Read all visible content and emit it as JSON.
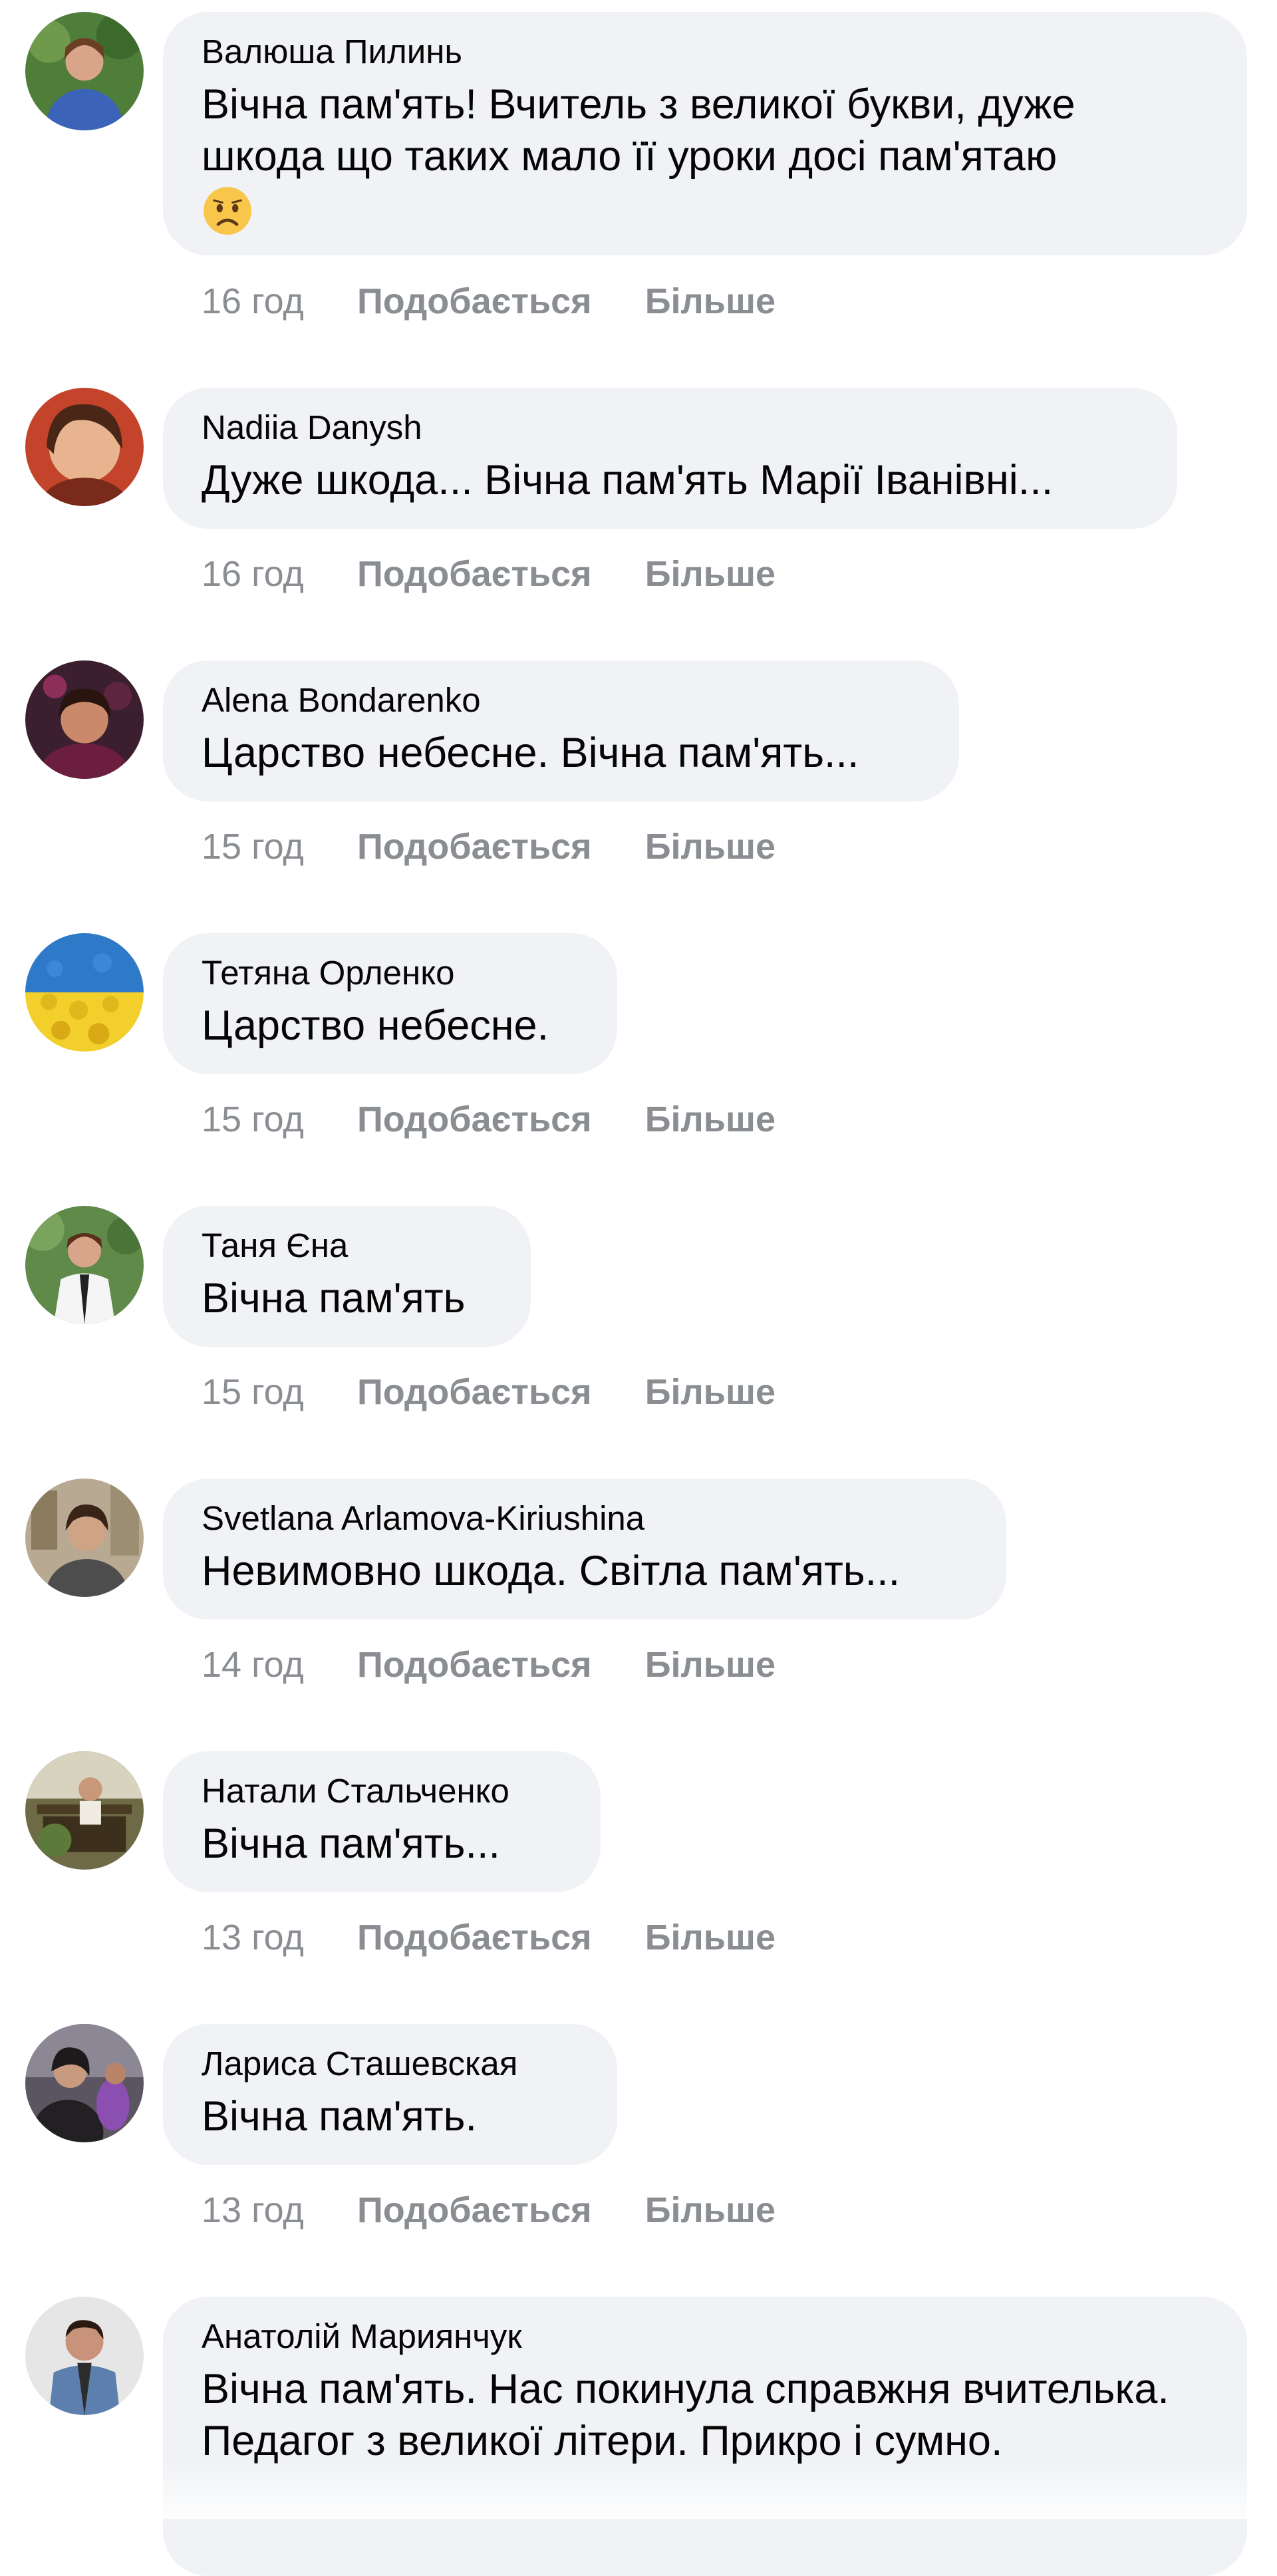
{
  "comments": [
    {
      "author": "Валюша Пилинь",
      "text": "Вічна пам'ять! Вчитель з великої букви, дуже шкода що таких мало її уроки досі пам'ятаю",
      "emoji": "sad-face-emoji",
      "time": "16 год",
      "like": "Подобається",
      "more": "Більше"
    },
    {
      "author": "Nadiia Danysh",
      "text": "Дуже шкода... Вічна пам'ять Марії Іванівні...",
      "time": "16 год",
      "like": "Подобається",
      "more": "Більше"
    },
    {
      "author": "Alena Bondarenko",
      "text": "Царство небесне. Вічна пам'ять...",
      "time": "15 год",
      "like": "Подобається",
      "more": "Більше"
    },
    {
      "author": "Тетяна Орленко",
      "text": "Царство небесне.",
      "time": "15 год",
      "like": "Подобається",
      "more": "Більше"
    },
    {
      "author": "Таня Єна",
      "text": "Вічна пам'ять",
      "time": "15 год",
      "like": "Подобається",
      "more": "Більше"
    },
    {
      "author": "Svetlana Arlamova-Kiriushina",
      "text": "Невимовно шкода. Світла пам'ять...",
      "time": "14 год",
      "like": "Подобається",
      "more": "Більше"
    },
    {
      "author": "Натали Стальченко",
      "text": "Вічна пам'ять...",
      "time": "13 год",
      "like": "Подобається",
      "more": "Більше"
    },
    {
      "author": "Лариса Сташевская",
      "text": "Вічна пам'ять.",
      "time": "13 год",
      "like": "Подобається",
      "more": "Більше"
    },
    {
      "author": "Анатолій Мариянчук",
      "text": "Вічна пам'ять. Нас покинула справжня вчителька. Педагог з великої літери. Прикро і сумно."
    }
  ],
  "colors": {
    "bubble": "#f0f2f5",
    "meta_text": "#8a8d91",
    "body_text": "#050505"
  }
}
